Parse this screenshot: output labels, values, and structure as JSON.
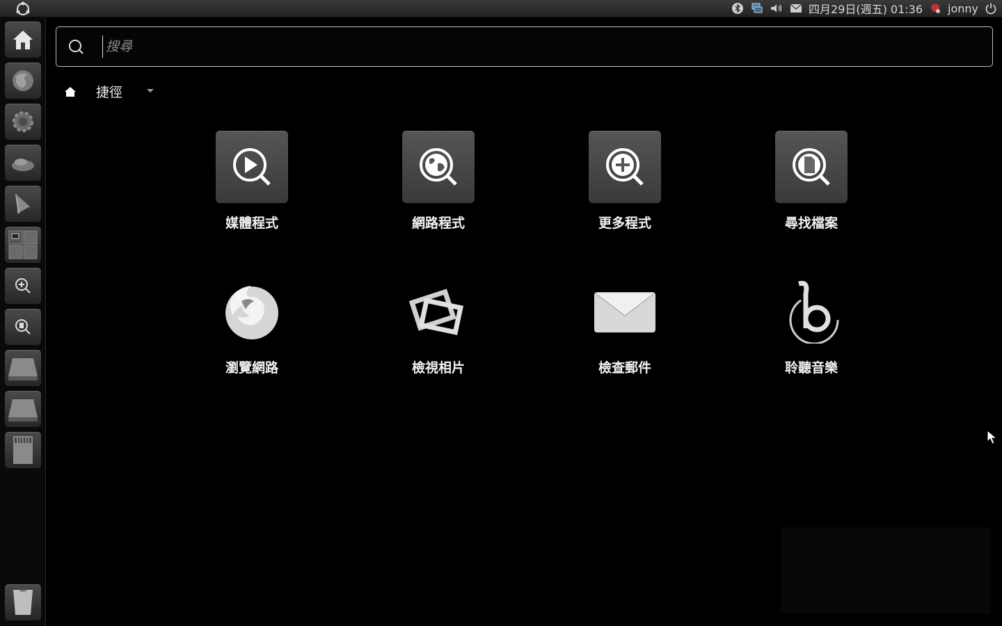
{
  "panel": {
    "datetime": "四月29日(週五) 01:36",
    "username": "jonny"
  },
  "search": {
    "placeholder": "搜尋"
  },
  "breadcrumb": {
    "label": "捷徑"
  },
  "shortcuts": [
    {
      "label": "媒體程式",
      "icon": "media-apps-icon"
    },
    {
      "label": "網路程式",
      "icon": "internet-apps-icon"
    },
    {
      "label": "更多程式",
      "icon": "more-apps-icon"
    },
    {
      "label": "尋找檔案",
      "icon": "find-files-icon"
    },
    {
      "label": "瀏覽網路",
      "icon": "firefox-icon"
    },
    {
      "label": "檢視相片",
      "icon": "shotwell-icon"
    },
    {
      "label": "檢查郵件",
      "icon": "mail-icon"
    },
    {
      "label": "聆聽音樂",
      "icon": "banshee-icon"
    }
  ],
  "colors": {
    "background": "#000000",
    "tile_bg": "#454545",
    "panel_bg": "#2e2e2c"
  }
}
